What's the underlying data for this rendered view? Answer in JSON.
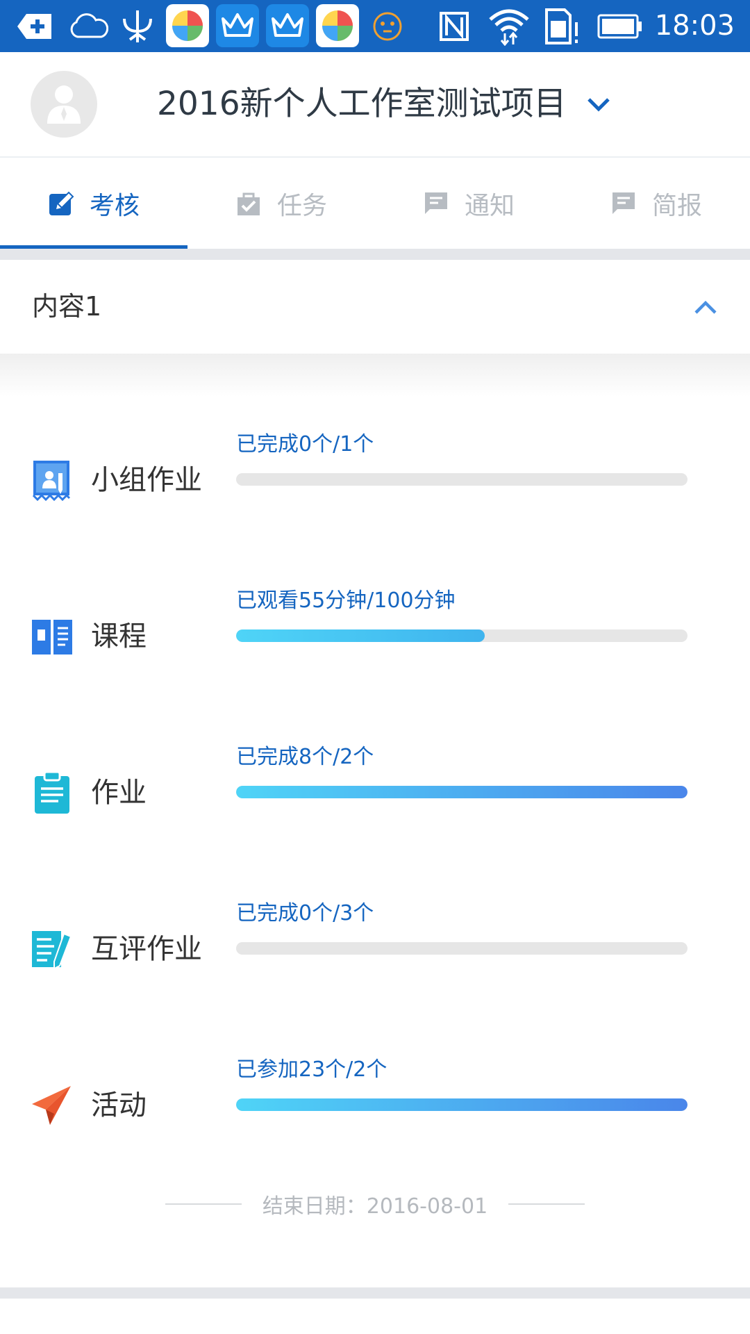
{
  "status_bar": {
    "time": "18:03",
    "icons": [
      "add-notification-icon",
      "cloud-icon",
      "trident-icon",
      "pinwheel-app-icon",
      "crown-app-icon",
      "crown-app-icon",
      "pinwheel-app-icon",
      "face-icon",
      "nfc-icon",
      "wifi-icon",
      "sim-card-icon",
      "battery-icon"
    ],
    "background": "#1565c0"
  },
  "header": {
    "project_title": "2016新个人工作室测试项目",
    "avatar_icon": "user-placeholder-icon",
    "dropdown_icon": "chevron-down-icon"
  },
  "tabs": [
    {
      "label": "考核",
      "icon": "assessment-icon",
      "active": true
    },
    {
      "label": "任务",
      "icon": "task-icon",
      "active": false
    },
    {
      "label": "通知",
      "icon": "notice-icon",
      "active": false
    },
    {
      "label": "简报",
      "icon": "briefing-icon",
      "active": false
    }
  ],
  "section": {
    "title": "内容1",
    "collapse_icon": "chevron-up-icon"
  },
  "items": [
    {
      "label": "小组作业",
      "icon": "group-homework-icon",
      "icon_color": "#2d7be5",
      "progress_text": "已完成0个/1个",
      "progress": 0.0
    },
    {
      "label": "课程",
      "icon": "course-book-icon",
      "icon_color": "#2d7be5",
      "progress_text": "已观看55分钟/100分钟",
      "progress": 0.55
    },
    {
      "label": "作业",
      "icon": "clipboard-icon",
      "icon_color": "#1eb8d6",
      "progress_text": "已完成8个/2个",
      "progress": 1.0
    },
    {
      "label": "互评作业",
      "icon": "peer-review-icon",
      "icon_color": "#1eb8d6",
      "progress_text": "已完成0个/3个",
      "progress": 0.0
    },
    {
      "label": "活动",
      "icon": "paper-plane-icon",
      "icon_color": "#e8552d",
      "progress_text": "已参加23个/2个",
      "progress": 1.0
    }
  ],
  "end_date": "结束日期：2016-08-01",
  "colors": {
    "accent": "#1565c0",
    "inactive_tab": "#b7bcc2",
    "bar_track": "#e6e6e6",
    "bar_gradient_start": "#4fd4f7",
    "bar_gradient_end": "#4a86ea"
  }
}
